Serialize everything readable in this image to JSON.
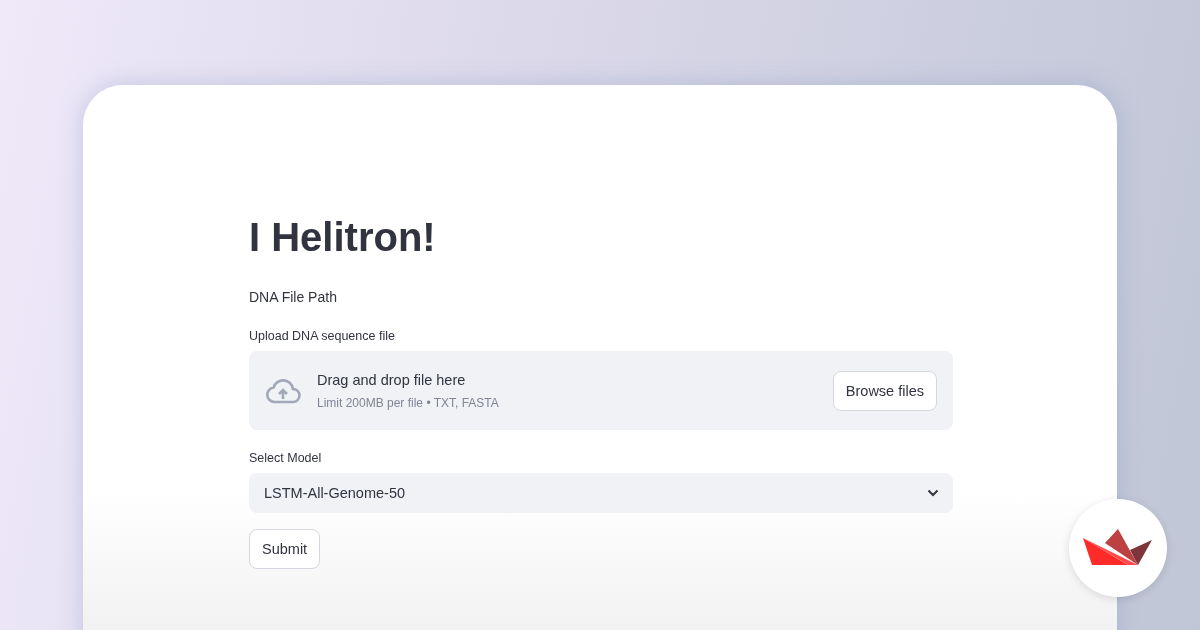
{
  "title": "I Helitron!",
  "caption": "DNA File Path",
  "uploader": {
    "label": "Upload DNA sequence file",
    "instruction": "Drag and drop file here",
    "limit": "Limit 200MB per file • TXT, FASTA",
    "button": "Browse files"
  },
  "model_select": {
    "label": "Select Model",
    "value": "LSTM-All-Genome-50"
  },
  "submit_button": "Submit"
}
